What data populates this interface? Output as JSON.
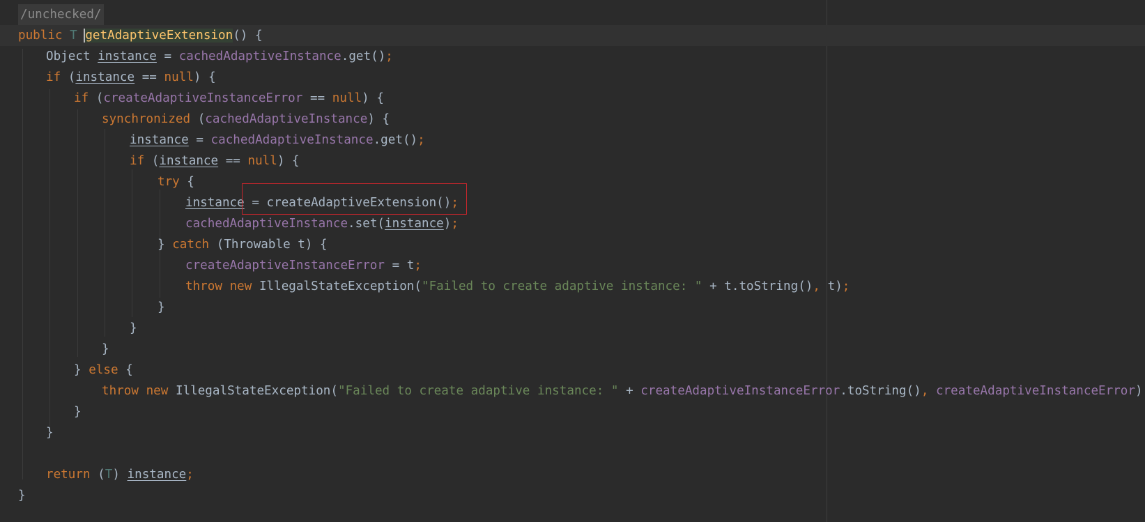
{
  "editor": {
    "annotation": "/unchecked/",
    "tokens": {
      "public": "public",
      "T": "T",
      "method_name": "getAdaptiveExtension",
      "Object": "Object",
      "instance": "instance",
      "cachedAdaptiveInstance": "cachedAdaptiveInstance",
      "get": "get",
      "set": "set",
      "if": "if",
      "null": "null",
      "createAdaptiveInstanceError": "createAdaptiveInstanceError",
      "synchronized": "synchronized",
      "try": "try",
      "createAdaptiveExtension": "createAdaptiveExtension",
      "catch": "catch",
      "Throwable": "Throwable",
      "t": "t",
      "throw": "throw",
      "new": "new",
      "IllegalStateException": "IllegalStateException",
      "message": "\"Failed to create adaptive instance: \"",
      "toString": "toString",
      "else": "else",
      "return": "return"
    },
    "theme": {
      "background": "#2b2b2b",
      "keyword": "#cc7832",
      "field": "#9876aa",
      "string": "#6a8759",
      "method_declaration": "#ffc66d",
      "default_text": "#a9b7c6",
      "highlight_box": "#c8262c"
    }
  }
}
